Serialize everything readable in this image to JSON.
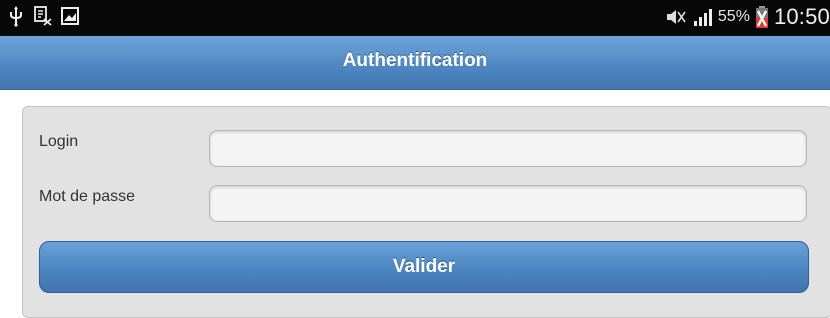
{
  "status_bar": {
    "left_icons": [
      "usb-icon",
      "screen-reader-icon",
      "screenshot-icon"
    ],
    "right_icons": [
      "mute-icon",
      "signal-icon",
      "battery-icon"
    ],
    "battery": "55%",
    "time": "10:50"
  },
  "header": {
    "title": "Authentification"
  },
  "form": {
    "login_label": "Login",
    "login_value": "",
    "password_label": "Mot de passe",
    "password_value": "",
    "submit_label": "Valider"
  },
  "colors": {
    "header_blue": "#4d86c0",
    "button_blue": "#4c85c1",
    "panel_gray": "#e2e2e2",
    "battery_red": "#e53935"
  }
}
